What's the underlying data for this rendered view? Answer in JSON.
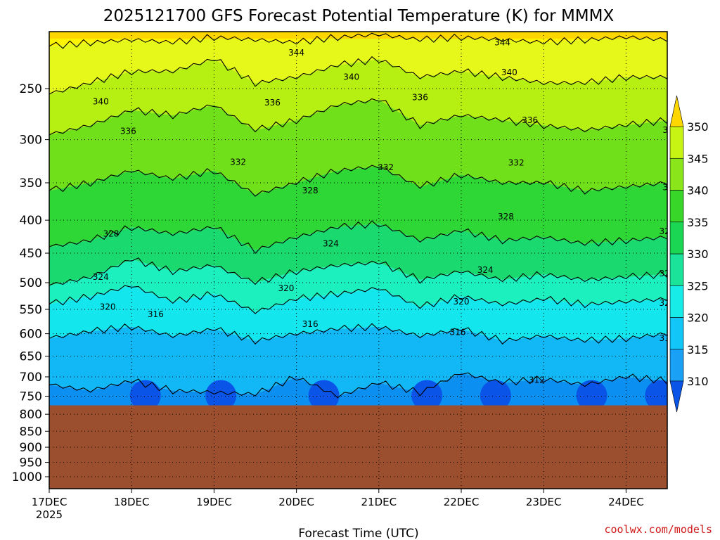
{
  "title": "2025121700 GFS Forecast Potential Temperature (K) for MMMX",
  "credit": "coolwx.com/models",
  "colors": {
    "ground": "#9c4f2e",
    "levels": [
      "#0a55e8",
      "#0b8ff0",
      "#12b8f5",
      "#14e6ee",
      "#1cf0bf",
      "#1ad96f",
      "#2ed636",
      "#6fe01a",
      "#b6ef12",
      "#e6f81a",
      "#fff400",
      "#ffd700"
    ],
    "contour": "#000000",
    "credit": "#d01818"
  },
  "chart_data": {
    "type": "heatmap",
    "title": "2025121700 GFS Forecast Potential Temperature (K) for MMMX",
    "xlabel": "Forecast Time (UTC)",
    "ylabel": "",
    "y_axis": {
      "scale": "pressure (inverted)",
      "ticks": [
        "250",
        "300",
        "350",
        "400",
        "450",
        "500",
        "550",
        "600",
        "650",
        "700",
        "750",
        "800",
        "850",
        "900",
        "950",
        "1000"
      ],
      "range": [
        1000,
        200
      ]
    },
    "x_axis": {
      "range": [
        "2025-12-17 00Z",
        "2025-12-24 12Z"
      ],
      "ticks": [
        {
          "label": "17DEC",
          "sublabel": "2025"
        },
        {
          "label": "18DEC"
        },
        {
          "label": "19DEC"
        },
        {
          "label": "20DEC"
        },
        {
          "label": "21DEC"
        },
        {
          "label": "22DEC"
        },
        {
          "label": "23DEC"
        },
        {
          "label": "24DEC"
        }
      ]
    },
    "colorbar": {
      "labels": [
        "310",
        "315",
        "320",
        "325",
        "330",
        "335",
        "340",
        "345",
        "350"
      ],
      "units": "K"
    },
    "ground_level_hpa": 775,
    "grid": true,
    "contours": [
      {
        "value": 312,
        "pressures": [
          720,
          735,
          710,
          735,
          740,
          745,
          700,
          750,
          715,
          740,
          690,
          715,
          705,
          720,
          700,
          710
        ]
      },
      {
        "value": 316,
        "pressures": [
          610,
          595,
          585,
          605,
          590,
          615,
          600,
          590,
          585,
          605,
          590,
          615,
          605,
          615,
          610,
          600
        ]
      },
      {
        "value": 320,
        "pressures": [
          540,
          525,
          505,
          535,
          520,
          555,
          530,
          520,
          510,
          545,
          525,
          540,
          530,
          540,
          535,
          530
        ]
      },
      {
        "value": 324,
        "pressures": [
          505,
          490,
          460,
          480,
          470,
          500,
          480,
          470,
          465,
          495,
          480,
          495,
          485,
          495,
          490,
          485
        ]
      },
      {
        "value": 328,
        "pressures": [
          440,
          430,
          410,
          420,
          410,
          445,
          425,
          410,
          405,
          430,
          415,
          430,
          425,
          435,
          430,
          425
        ]
      },
      {
        "value": 332,
        "pressures": [
          360,
          350,
          335,
          345,
          335,
          365,
          350,
          335,
          330,
          355,
          340,
          350,
          350,
          360,
          355,
          350
        ]
      },
      {
        "value": 336,
        "pressures": [
          295,
          285,
          270,
          275,
          265,
          290,
          280,
          265,
          260,
          285,
          275,
          280,
          285,
          290,
          285,
          280
        ]
      },
      {
        "value": 340,
        "pressures": [
          255,
          245,
          235,
          235,
          225,
          245,
          240,
          230,
          225,
          240,
          235,
          240,
          245,
          245,
          240,
          240
        ]
      },
      {
        "value": 344,
        "pressures": [
          215,
          212,
          210,
          212,
          208,
          210,
          212,
          208,
          206,
          210,
          208,
          210,
          212,
          210,
          208,
          210
        ]
      }
    ],
    "contour_labels": [
      {
        "value": "344",
        "time_hr": 72,
        "pressure": 220
      },
      {
        "value": "344",
        "time_hr": 132,
        "pressure": 212
      },
      {
        "value": "344",
        "time_hr": 182,
        "pressure": 212
      },
      {
        "value": "340",
        "time_hr": 88,
        "pressure": 240
      },
      {
        "value": "340",
        "time_hr": 134,
        "pressure": 236
      },
      {
        "value": "340",
        "time_hr": 182,
        "pressure": 240
      },
      {
        "value": "340",
        "time_hr": 15,
        "pressure": 262
      },
      {
        "value": "336",
        "time_hr": 65,
        "pressure": 263
      },
      {
        "value": "336",
        "time_hr": 108,
        "pressure": 258
      },
      {
        "value": "336",
        "time_hr": 140,
        "pressure": 280
      },
      {
        "value": "336",
        "time_hr": 181,
        "pressure": 290
      },
      {
        "value": "336",
        "time_hr": 23,
        "pressure": 291
      },
      {
        "value": "332",
        "time_hr": 55,
        "pressure": 325
      },
      {
        "value": "332",
        "time_hr": 98,
        "pressure": 331
      },
      {
        "value": "332",
        "time_hr": 136,
        "pressure": 326
      },
      {
        "value": "332",
        "time_hr": 181,
        "pressure": 356
      },
      {
        "value": "328",
        "time_hr": 76,
        "pressure": 360
      },
      {
        "value": "328",
        "time_hr": 133,
        "pressure": 395
      },
      {
        "value": "328",
        "time_hr": 180,
        "pressure": 416
      },
      {
        "value": "328",
        "time_hr": 18,
        "pressure": 420
      },
      {
        "value": "324",
        "time_hr": 82,
        "pressure": 435
      },
      {
        "value": "324",
        "time_hr": 127,
        "pressure": 478
      },
      {
        "value": "324",
        "time_hr": 180,
        "pressure": 484
      },
      {
        "value": "324",
        "time_hr": 15,
        "pressure": 490
      },
      {
        "value": "320",
        "time_hr": 69,
        "pressure": 510
      },
      {
        "value": "320",
        "time_hr": 120,
        "pressure": 535
      },
      {
        "value": "320",
        "time_hr": 180,
        "pressure": 538
      },
      {
        "value": "320",
        "time_hr": 17,
        "pressure": 545
      },
      {
        "value": "316",
        "time_hr": 31,
        "pressure": 560
      },
      {
        "value": "316",
        "time_hr": 76,
        "pressure": 580
      },
      {
        "value": "316",
        "time_hr": 119,
        "pressure": 597
      },
      {
        "value": "316",
        "time_hr": 180,
        "pressure": 610
      },
      {
        "value": "312",
        "time_hr": 142,
        "pressure": 708
      },
      {
        "value": "312",
        "time_hr": 186,
        "pressure": 688
      }
    ]
  }
}
